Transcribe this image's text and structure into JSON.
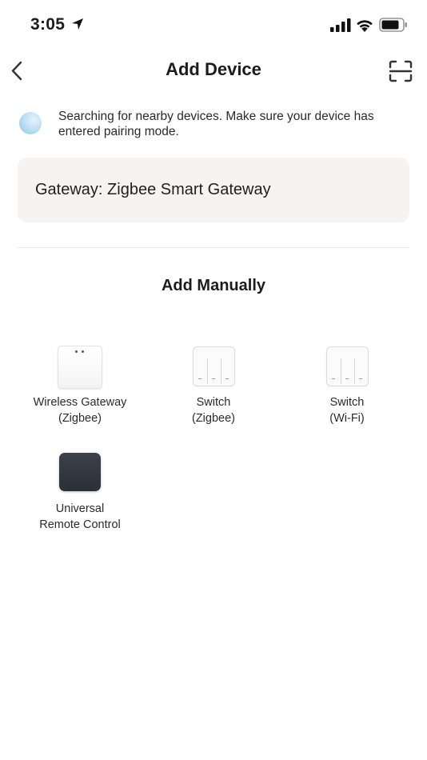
{
  "status_bar": {
    "time": "3:05"
  },
  "header": {
    "title": "Add Device"
  },
  "search_notice": {
    "text": "Searching for nearby devices. Make sure your device has entered pairing mode."
  },
  "gateway_card": {
    "text": "Gateway: Zigbee Smart Gateway"
  },
  "manual": {
    "title": "Add Manually",
    "devices": [
      {
        "line1": "Wireless Gateway",
        "line2": "(Zigbee)",
        "icon": "gateway-icon"
      },
      {
        "line1": "Switch",
        "line2": "(Zigbee)",
        "icon": "switch-icon"
      },
      {
        "line1": "Switch",
        "line2": "(Wi-Fi)",
        "icon": "switch-icon"
      },
      {
        "line1": "Universal",
        "line2": "Remote Control",
        "icon": "remote-icon"
      }
    ]
  },
  "colors": {
    "card_bg": "#f7f3f0",
    "remote": "#2f333c",
    "search_indicator": "#8cc6ea"
  }
}
